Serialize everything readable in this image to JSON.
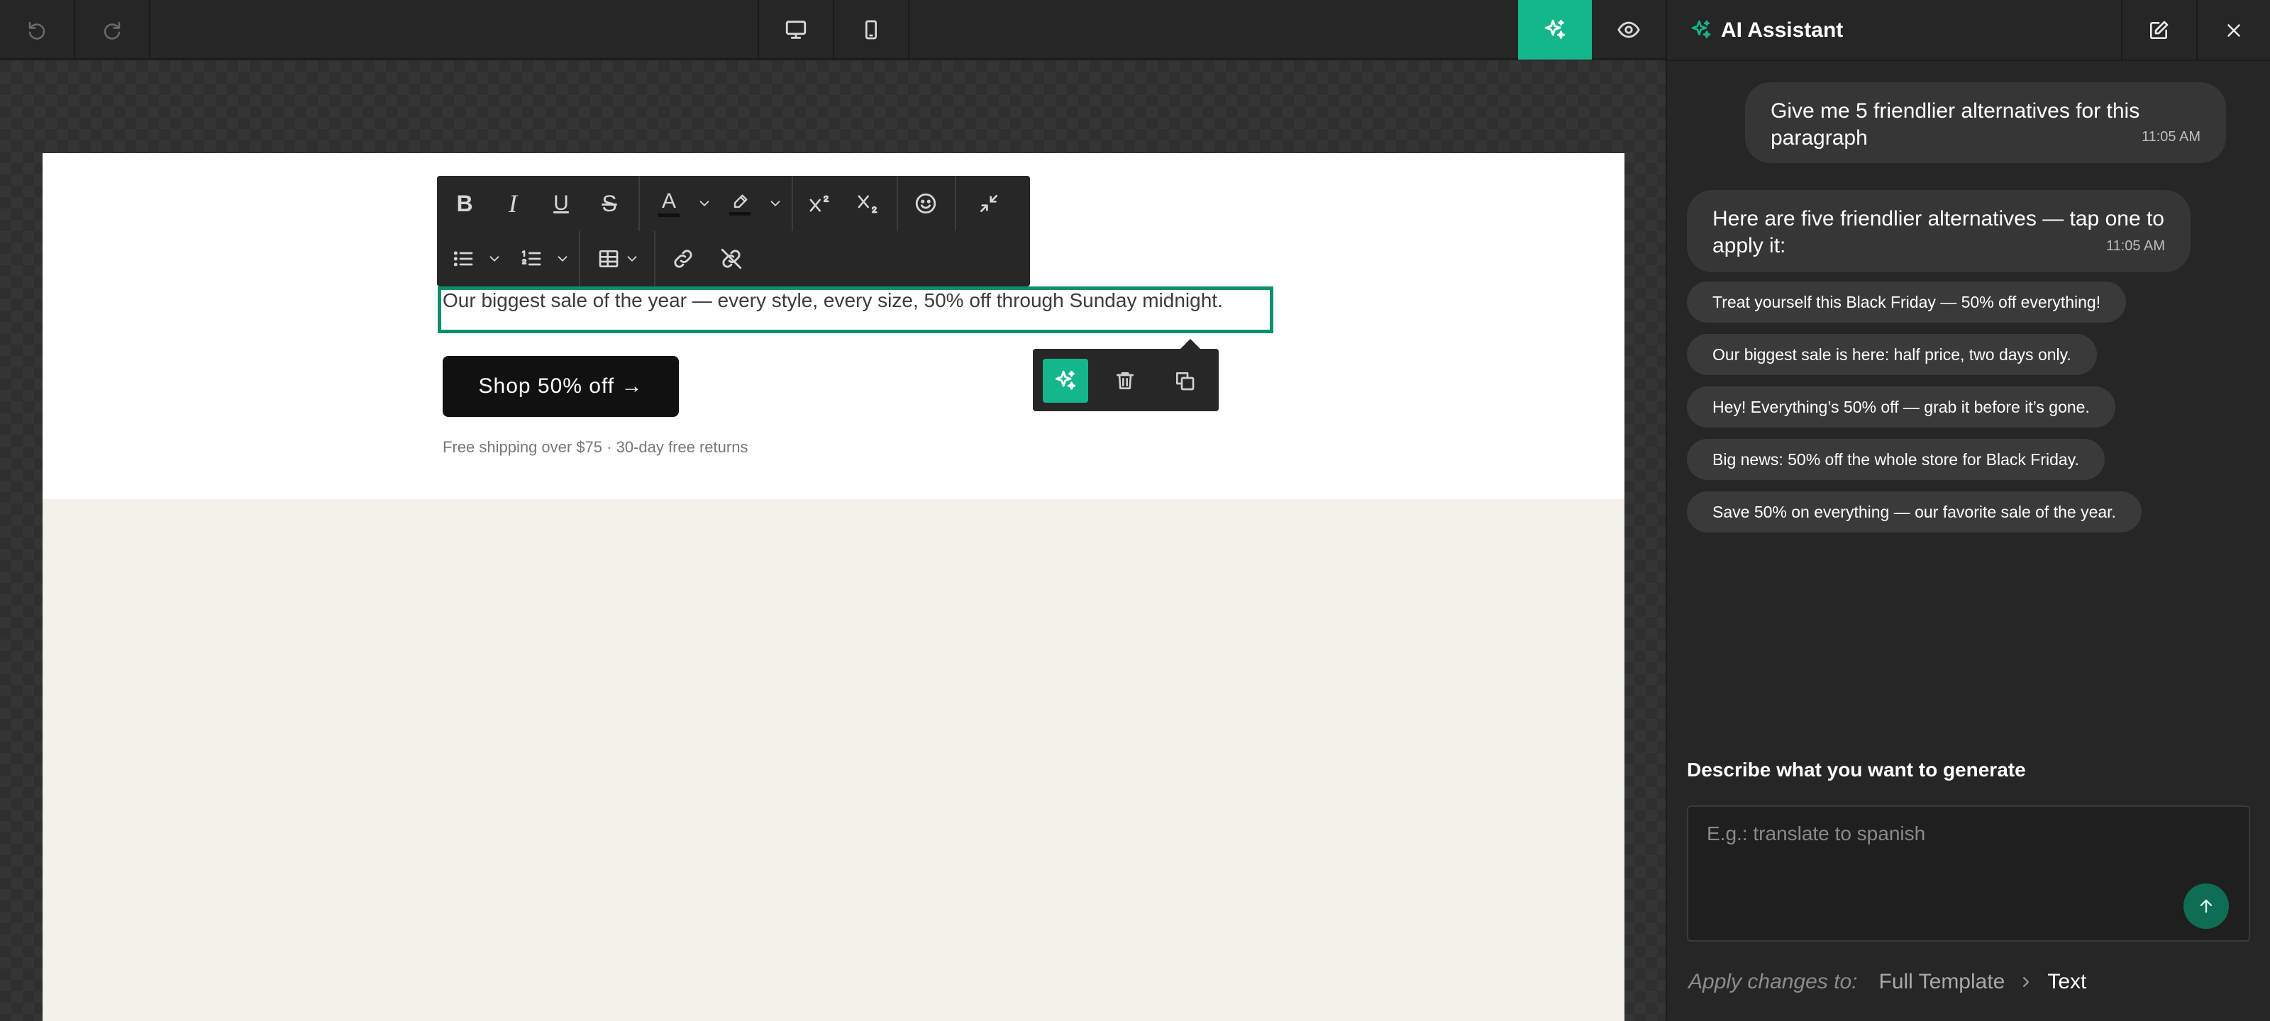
{
  "toolbar": {
    "undo_icon": "undo-icon",
    "redo_icon": "redo-icon",
    "desktop_icon": "desktop-icon",
    "mobile_icon": "mobile-icon",
    "ai_icon": "sparkles-icon",
    "preview_icon": "eye-icon",
    "accent_color": "#14b78b"
  },
  "email": {
    "paragraph": "Our biggest sale of the year — every style, every size, 50% off through Sunday midnight.",
    "cta_label": "Shop 50% off →",
    "shipping_note": "Free shipping over $75 · 30-day free returns",
    "selection_color": "#0d8f6d",
    "background_color": "#f4f0ea"
  },
  "format_toolbar": {
    "row1": [
      "bold",
      "italic",
      "underline",
      "strikethrough",
      "text-color",
      "highlight-color",
      "superscript",
      "subscript",
      "emoji",
      "collapse"
    ],
    "row2": [
      "bulleted-list",
      "numbered-list",
      "table",
      "link",
      "unlink"
    ],
    "bold_glyph": "B",
    "italic_glyph": "I",
    "underline_glyph": "U",
    "strike_glyph": "S",
    "text_color_glyph": "A"
  },
  "block_actions": [
    "ai-rewrite",
    "delete",
    "duplicate"
  ],
  "assistant": {
    "title": "AI Assistant",
    "messages": [
      {
        "role": "user",
        "text": "Give me 5 friendlier alternatives for this paragraph",
        "time": "11:05 AM"
      },
      {
        "role": "assistant",
        "text": "Here are five friendlier alternatives — tap one to apply it:",
        "time": "11:05 AM"
      }
    ],
    "suggestions": [
      "Treat yourself this Black Friday — 50% off everything!",
      "Our biggest sale is here: half price, two days only.",
      "Hey! Everything’s 50% off — grab it before it’s gone.",
      "Big news: 50% off the whole store for Black Friday.",
      "Save 50% on everything — our favorite sale of the year."
    ],
    "generate_label": "Describe what you want to generate",
    "input_placeholder": "E.g.: translate to spanish",
    "input_value": "",
    "apply_label": "Apply changes to:",
    "scope_options": [
      "Full Template",
      "Text"
    ],
    "scope_selected": "Text"
  }
}
